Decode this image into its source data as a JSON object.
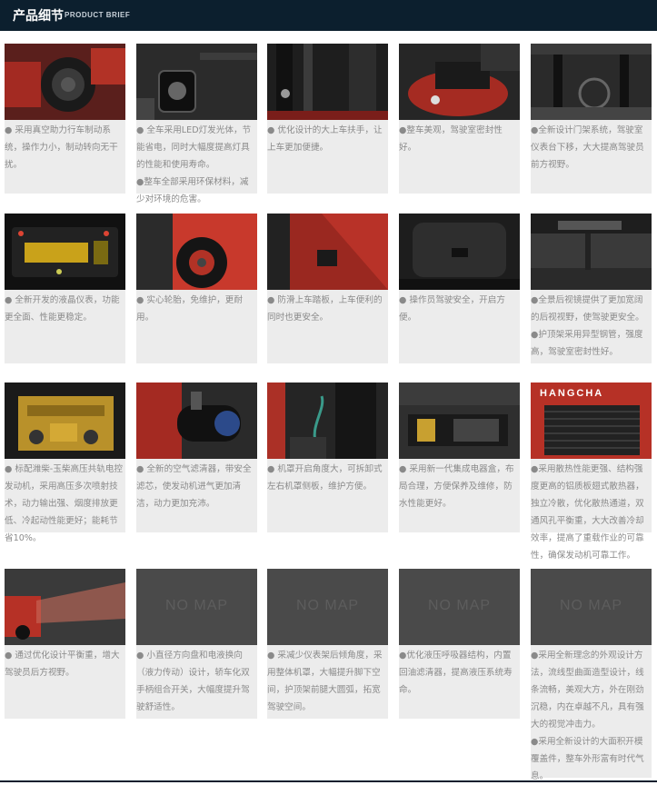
{
  "header": {
    "title": "产品细节",
    "subtitle": "PRODUCT BRIEF"
  },
  "placeholder_text": "NO MAP",
  "brand_badge": "HANGCHA",
  "rows": [
    {
      "items": [
        {
          "icon": "steering-axle-photo",
          "desc": "● 采用真空助力行车制动系统，操作力小，制动转向无干扰。"
        },
        {
          "icon": "led-headlight-photo",
          "desc": "● 全车采用LED灯发光体，节能省电，同时大幅度提高灯具的性能和使用寿命。\n●整车全部采用环保材料，减少对环境的危害。"
        },
        {
          "icon": "grab-handle-photo",
          "desc": "● 优化设计的大上车扶手，让上车更加便捷。"
        },
        {
          "icon": "cab-sealing-photo",
          "desc": "●整车美观，驾驶室密封性好。"
        },
        {
          "icon": "mast-system-photo",
          "desc": "●全新设计门架系统，驾驶室仪表台下移，大大提高驾驶员前方视野。"
        }
      ]
    },
    {
      "items": [
        {
          "icon": "lcd-dashboard-photo",
          "desc": "● 全新开发的液晶仪表，功能更全面、性能更稳定。"
        },
        {
          "icon": "solid-tire-photo",
          "desc": "● 实心轮胎，免维护，更耐用。"
        },
        {
          "icon": "step-plate-photo",
          "desc": "● 防滑上车踏板，上车便利的同时也更安全。"
        },
        {
          "icon": "operator-seat-photo",
          "desc": "● 操作员驾驶安全，开启方便。"
        },
        {
          "icon": "rear-mirror-photo",
          "desc": "●全景后视镜提供了更加宽阔的后视视野，使驾驶更安全。\n●护顶架采用异型钢管，强度高，驾驶室密封性好。"
        }
      ]
    },
    {
      "items": [
        {
          "icon": "diesel-engine-photo",
          "desc": "● 标配潍柴-玉柴高压共轨电控发动机，采用高压多次喷射技术，动力输出强、烟度排放更低、冷起动性能更好；能耗节省10%。"
        },
        {
          "icon": "air-filter-photo",
          "desc": "● 全新的空气滤清器，带安全滤芯，使发动机进气更加清洁，动力更加充沛。"
        },
        {
          "icon": "engine-hood-photo",
          "desc": "● 机罩开启角度大，可拆卸式左右机罩侧板，维护方便。"
        },
        {
          "icon": "electrical-box-photo",
          "desc": "● 采用新一代集成电器盒，布局合理，方便保养及维修，防水性能更好。"
        },
        {
          "icon": "radiator-photo",
          "desc": "●采用散热性能更强、结构强度更高的铝质板翅式散热器，独立冷散，优化散热通道，双通风孔平衡重，大大改善冷却效率，提高了重载作业的可靠性，确保发动机可靠工作。"
        }
      ]
    },
    {
      "items": [
        {
          "icon": "counterweight-photo",
          "desc": "● 通过优化设计平衡重，增大驾驶员后方视野。"
        },
        {
          "icon": "no-map-placeholder",
          "desc": "● 小直径方向盘和电液换向（液力传动）设计，轿车化双手柄组合开关，大幅度提升驾驶舒适性。"
        },
        {
          "icon": "no-map-placeholder",
          "desc": "● 采减少仪表架后倾角度，采用整体机罩，大幅提升脚下空间，护顶架前腿大圆弧，拓宽驾驶空间。"
        },
        {
          "icon": "no-map-placeholder",
          "desc": "●优化液压呼吸器结构，内置回油滤清器，提高液压系统寿命。"
        },
        {
          "icon": "no-map-placeholder",
          "desc": "●采用全新理念的外观设计方法，流线型曲面造型设计，线条流畅，美观大方，外在刚劲沉稳，内在卓越不凡，具有强大的视觉冲击力。\n●采用全新设计的大面积开模覆盖件，整车外形富有时代气息。"
        }
      ]
    }
  ]
}
